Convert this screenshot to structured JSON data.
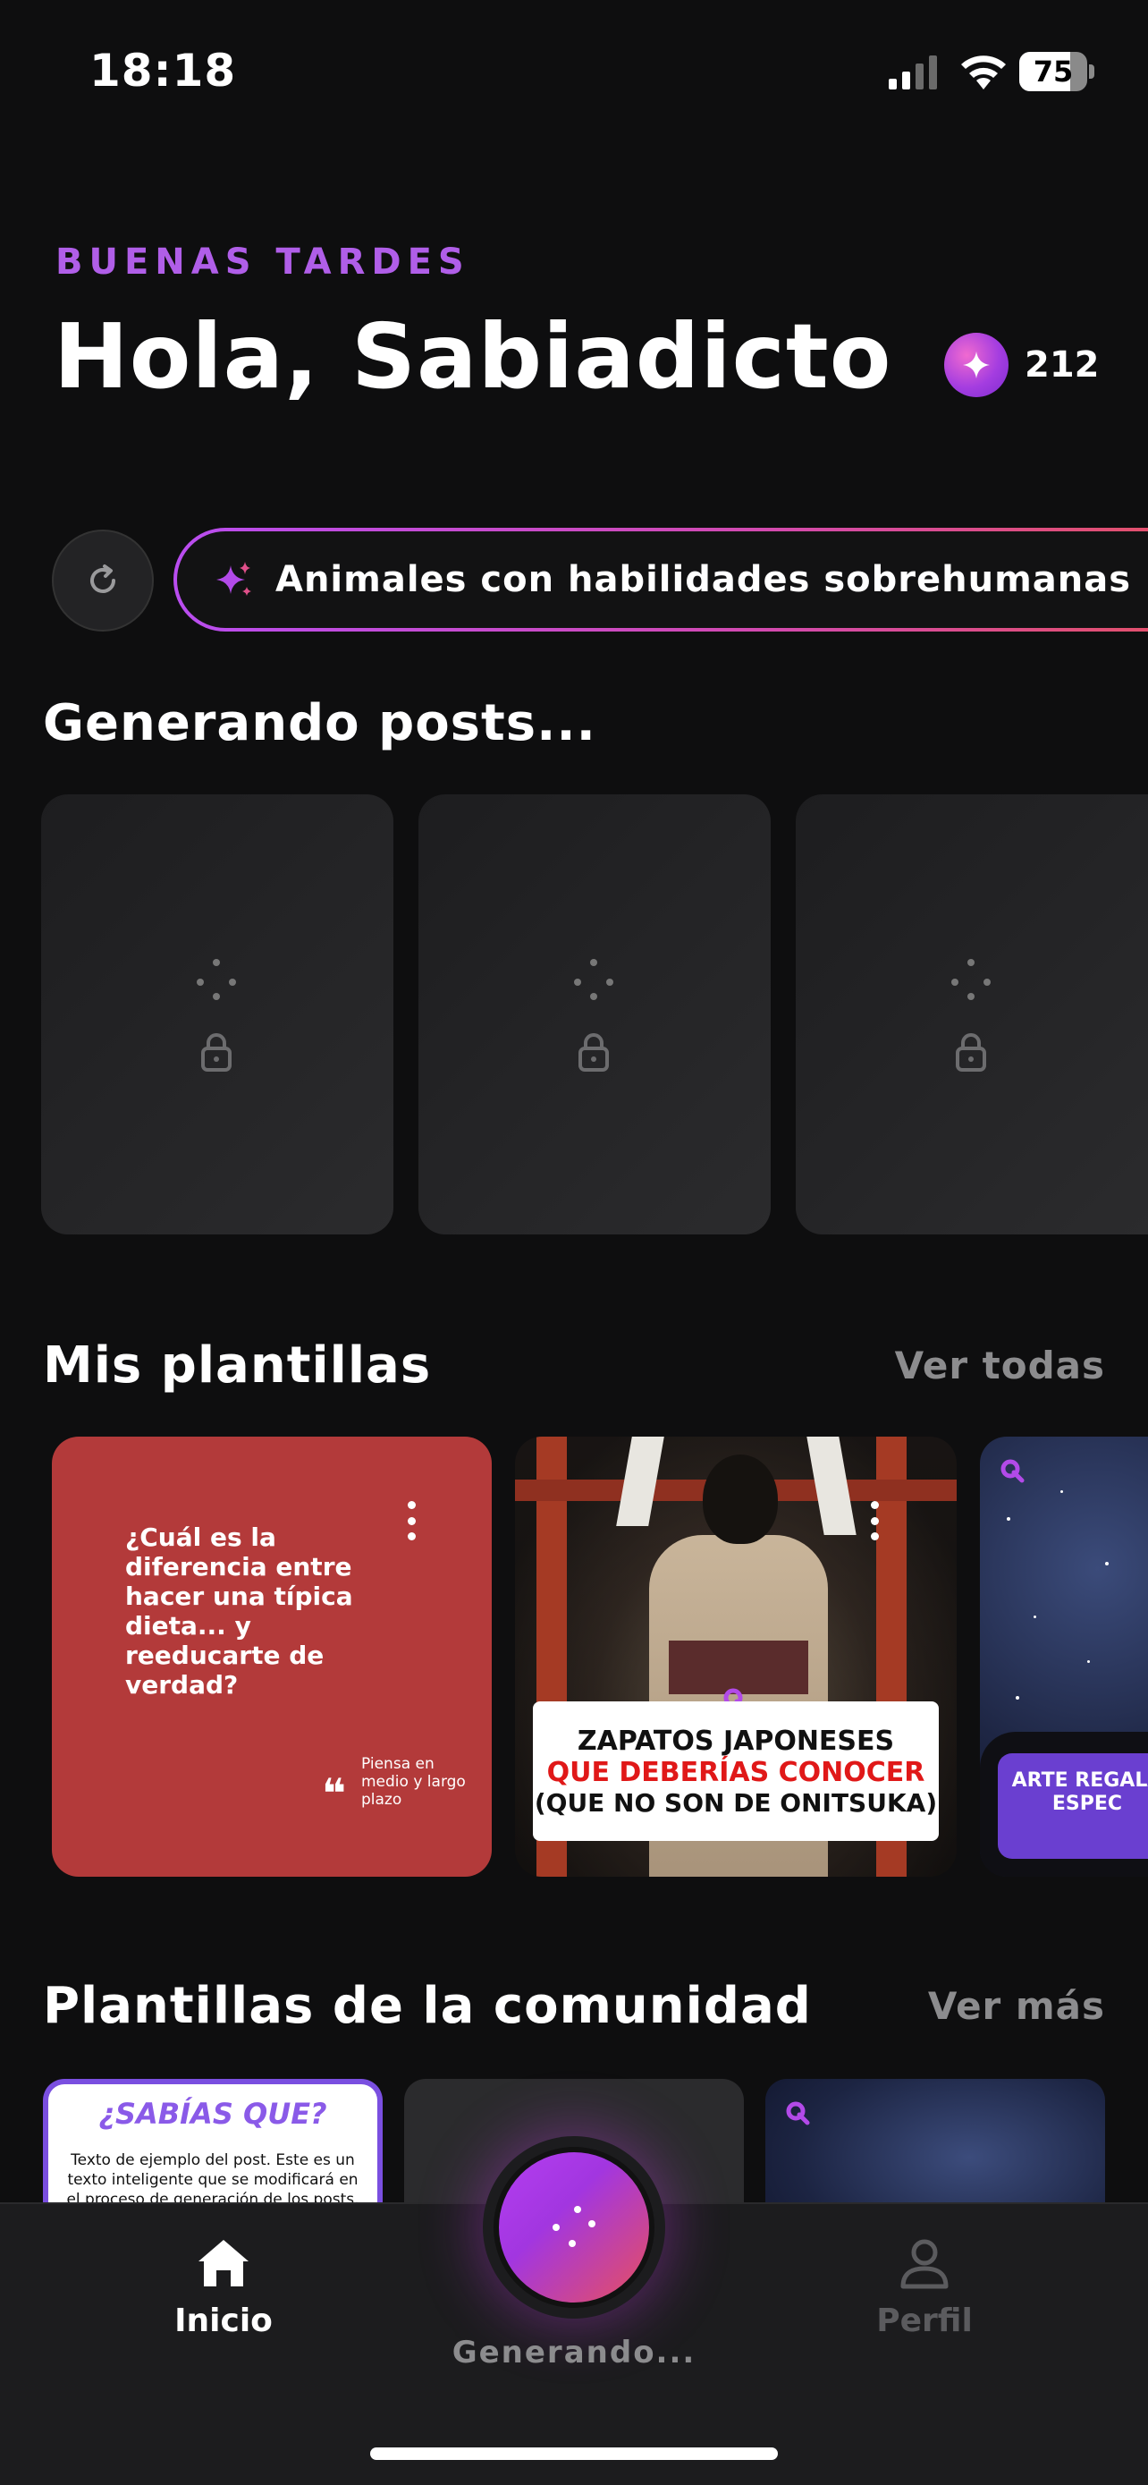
{
  "status_bar": {
    "time": "18:18",
    "battery": "75",
    "battery_level": 0.75
  },
  "header": {
    "greeting": "BUENAS TARDES",
    "title": "Hola, Sabiadicto",
    "credits": "212"
  },
  "topic": {
    "label": "Animales con habilidades sobrehumanas"
  },
  "generating": {
    "title": "Generando posts...",
    "cards_count": 3
  },
  "my_templates": {
    "title": "Mis plantillas",
    "link": "Ver todas",
    "items": [
      {
        "question": "¿Cuál es la diferencia entre hacer una típica dieta... y reeducarte de verdad?",
        "side_text": "Piensa en medio y largo plazo",
        "background": "#b33a3a"
      },
      {
        "line1": "ZAPATOS JAPONESES",
        "line2": "QUE DEBERÍAS CONOCER",
        "line3": "(QUE NO SON DE ONITSUKA)"
      },
      {
        "text": "ARTE REGALA ESPEC"
      }
    ]
  },
  "community": {
    "title": "Plantillas de la comunidad",
    "link": "Ver más",
    "items": [
      {
        "heading": "¿SABÍAS QUE?",
        "body": "Texto de ejemplo del post. Este es un texto inteligente que se modificará en el proceso de generación de los posts."
      }
    ]
  },
  "tabbar": {
    "home": "Inicio",
    "generating": "Generando...",
    "profile": "Perfil"
  },
  "colors": {
    "accent_purple": "#b05ee8",
    "accent_pink": "#e2506e",
    "background": "#0e0e0f",
    "card": "#1d1d1f"
  },
  "icons": [
    "signal-icon",
    "wifi-icon",
    "battery-icon",
    "sparkle-icon",
    "refresh-icon",
    "lock-icon",
    "home-icon",
    "profile-icon",
    "kebab-icon"
  ]
}
